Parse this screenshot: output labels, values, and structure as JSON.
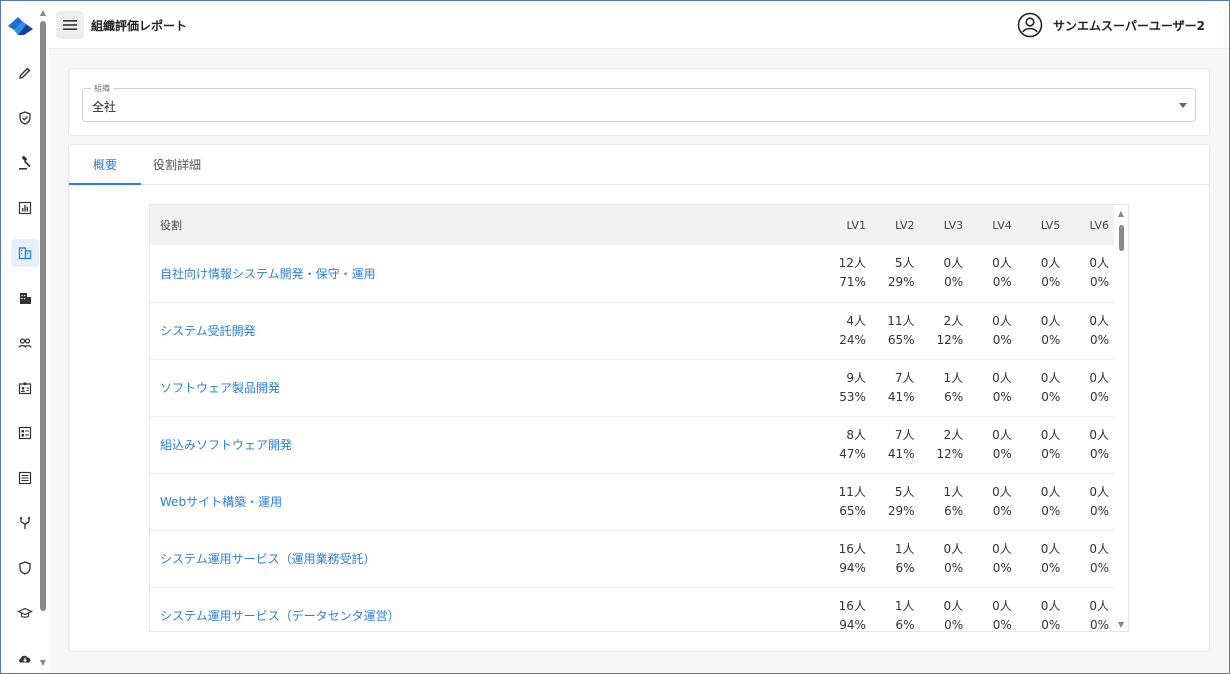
{
  "header": {
    "title": "組織評価レポート",
    "user_name": "サンエムスーパーユーザー2"
  },
  "sidebar": {
    "items": [
      {
        "icon": "pencil-icon"
      },
      {
        "icon": "shield-check-icon"
      },
      {
        "icon": "gavel-icon"
      },
      {
        "icon": "bar-chart-icon"
      },
      {
        "icon": "building-report-icon",
        "active": true
      },
      {
        "icon": "buildings-icon"
      },
      {
        "icon": "people-icon"
      },
      {
        "icon": "id-card-icon"
      },
      {
        "icon": "list-card-icon"
      },
      {
        "icon": "checklist-icon"
      },
      {
        "icon": "fork-icon"
      },
      {
        "icon": "shield-icon"
      },
      {
        "icon": "graduation-cap-icon"
      },
      {
        "icon": "cloud-download-icon"
      }
    ]
  },
  "org_select": {
    "label": "組織",
    "value": "全社"
  },
  "tabs": [
    {
      "label": "概要",
      "active": true
    },
    {
      "label": "役割詳細",
      "active": false
    }
  ],
  "table": {
    "headers": [
      "役割",
      "LV1",
      "LV2",
      "LV3",
      "LV4",
      "LV5",
      "LV6"
    ],
    "rows": [
      {
        "role": "自社向け情報システム開発・保守・運用",
        "cells": [
          [
            "12人",
            "71%"
          ],
          [
            "5人",
            "29%"
          ],
          [
            "0人",
            "0%"
          ],
          [
            "0人",
            "0%"
          ],
          [
            "0人",
            "0%"
          ],
          [
            "0人",
            "0%"
          ]
        ]
      },
      {
        "role": "システム受託開発",
        "cells": [
          [
            "4人",
            "24%"
          ],
          [
            "11人",
            "65%"
          ],
          [
            "2人",
            "12%"
          ],
          [
            "0人",
            "0%"
          ],
          [
            "0人",
            "0%"
          ],
          [
            "0人",
            "0%"
          ]
        ]
      },
      {
        "role": "ソフトウェア製品開発",
        "cells": [
          [
            "9人",
            "53%"
          ],
          [
            "7人",
            "41%"
          ],
          [
            "1人",
            "6%"
          ],
          [
            "0人",
            "0%"
          ],
          [
            "0人",
            "0%"
          ],
          [
            "0人",
            "0%"
          ]
        ]
      },
      {
        "role": "組込みソフトウェア開発",
        "cells": [
          [
            "8人",
            "47%"
          ],
          [
            "7人",
            "41%"
          ],
          [
            "2人",
            "12%"
          ],
          [
            "0人",
            "0%"
          ],
          [
            "0人",
            "0%"
          ],
          [
            "0人",
            "0%"
          ]
        ]
      },
      {
        "role": "Webサイト構築・運用",
        "cells": [
          [
            "11人",
            "65%"
          ],
          [
            "5人",
            "29%"
          ],
          [
            "1人",
            "6%"
          ],
          [
            "0人",
            "0%"
          ],
          [
            "0人",
            "0%"
          ],
          [
            "0人",
            "0%"
          ]
        ]
      },
      {
        "role": "システム運用サービス（運用業務受託）",
        "cells": [
          [
            "16人",
            "94%"
          ],
          [
            "1人",
            "6%"
          ],
          [
            "0人",
            "0%"
          ],
          [
            "0人",
            "0%"
          ],
          [
            "0人",
            "0%"
          ],
          [
            "0人",
            "0%"
          ]
        ]
      },
      {
        "role": "システム運用サービス（データセンタ運営）",
        "cells": [
          [
            "16人",
            "94%"
          ],
          [
            "1人",
            "6%"
          ],
          [
            "0人",
            "0%"
          ],
          [
            "0人",
            "0%"
          ],
          [
            "0人",
            "0%"
          ],
          [
            "0人",
            "0%"
          ]
        ]
      }
    ]
  },
  "colors": {
    "accent": "#2f7fd5",
    "logo_blue": "#1f6fd1",
    "logo_dark": "#1a3d8f"
  }
}
